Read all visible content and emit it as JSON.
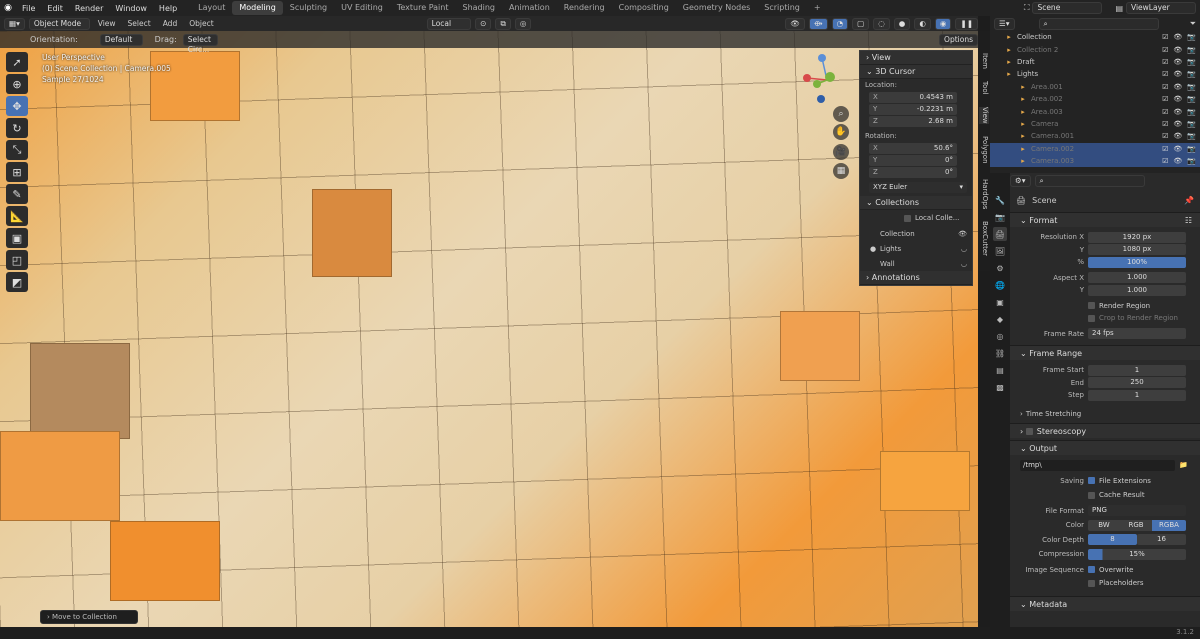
{
  "topbar": {
    "menus": [
      "File",
      "Edit",
      "Render",
      "Window",
      "Help"
    ],
    "workspaces": [
      "Layout",
      "Modeling",
      "Sculpting",
      "UV Editing",
      "Texture Paint",
      "Shading",
      "Animation",
      "Rendering",
      "Compositing",
      "Geometry Nodes",
      "Scripting"
    ],
    "active_workspace": "Modeling",
    "scene": "Scene",
    "view_layer": "ViewLayer"
  },
  "header": {
    "mode": "Object Mode",
    "menus": [
      "View",
      "Select",
      "Add",
      "Object"
    ],
    "transform_space": "Local"
  },
  "tool_header": {
    "orientation_label": "Orientation:",
    "orientation_value": "Default",
    "drag_label": "Drag:",
    "drag_value": "Select Circ...",
    "options": "Options"
  },
  "viewport": {
    "line1": "User Perspective",
    "line2": "(0) Scene Collection | Camera.005",
    "line3": "Sample 27/1024"
  },
  "npanel": {
    "view_label": "View",
    "cursor_label": "3D Cursor",
    "location_label": "Location:",
    "loc": {
      "x": "0.4543 m",
      "y": "-0.2231 m",
      "z": "2.68 m"
    },
    "rotation_label": "Rotation:",
    "rot": {
      "x": "50.6°",
      "y": "0°",
      "z": "0°"
    },
    "rotation_mode": "XYZ Euler",
    "collections_label": "Collections",
    "local_coll": "Local Colle...",
    "coll_items": [
      "Collection",
      "Lights",
      "Wall"
    ],
    "annotations_label": "Annotations",
    "axes": [
      "X",
      "Y",
      "Z"
    ]
  },
  "sidetabs": [
    "Item",
    "Tool",
    "View",
    "Polygon",
    "HardOps",
    "BoxCutter"
  ],
  "outliner": [
    {
      "name": "Collection",
      "dim": false,
      "sel": false
    },
    {
      "name": "Collection 2",
      "dim": true,
      "sel": false
    },
    {
      "name": "Draft",
      "dim": false,
      "sel": false
    },
    {
      "name": "Lights",
      "dim": false,
      "sel": false
    },
    {
      "name": "Area.001",
      "dim": true,
      "sel": false
    },
    {
      "name": "Area.002",
      "dim": true,
      "sel": false
    },
    {
      "name": "Area.003",
      "dim": true,
      "sel": false
    },
    {
      "name": "Camera",
      "dim": true,
      "sel": false
    },
    {
      "name": "Camera.001",
      "dim": true,
      "sel": false
    },
    {
      "name": "Camera.002",
      "dim": true,
      "sel": true
    },
    {
      "name": "Camera.003",
      "dim": true,
      "sel": true
    }
  ],
  "props": {
    "scene_name": "Scene",
    "format_label": "Format",
    "res_x_label": "Resolution X",
    "res_x": "1920 px",
    "res_y_label": "Y",
    "res_y": "1080 px",
    "pct_label": "%",
    "pct": "100%",
    "aspect_x_label": "Aspect X",
    "aspect_x": "1.000",
    "aspect_y_label": "Y",
    "aspect_y": "1.000",
    "render_region": "Render Region",
    "crop_region": "Crop to Render Region",
    "frame_rate_label": "Frame Rate",
    "frame_rate": "24 fps",
    "frame_range_label": "Frame Range",
    "frame_start_label": "Frame Start",
    "frame_start": "1",
    "end_label": "End",
    "end": "250",
    "step_label": "Step",
    "step": "1",
    "time_stretch": "Time Stretching",
    "stereo": "Stereoscopy",
    "output_label": "Output",
    "output_path": "/tmp\\",
    "saving_label": "Saving",
    "file_ext": "File Extensions",
    "cache_result": "Cache Result",
    "file_format_label": "File Format",
    "file_format": "PNG",
    "color_label": "Color",
    "color_opts": [
      "BW",
      "RGB",
      "RGBA"
    ],
    "depth_label": "Color Depth",
    "depth_opts": [
      "8",
      "16"
    ],
    "compression_label": "Compression",
    "compression": "15%",
    "img_seq_label": "Image Sequence",
    "overwrite": "Overwrite",
    "placeholders": "Placeholders",
    "metadata_label": "Metadata"
  },
  "status": {
    "toast": "Move to Collection",
    "version": "3.1.2"
  }
}
